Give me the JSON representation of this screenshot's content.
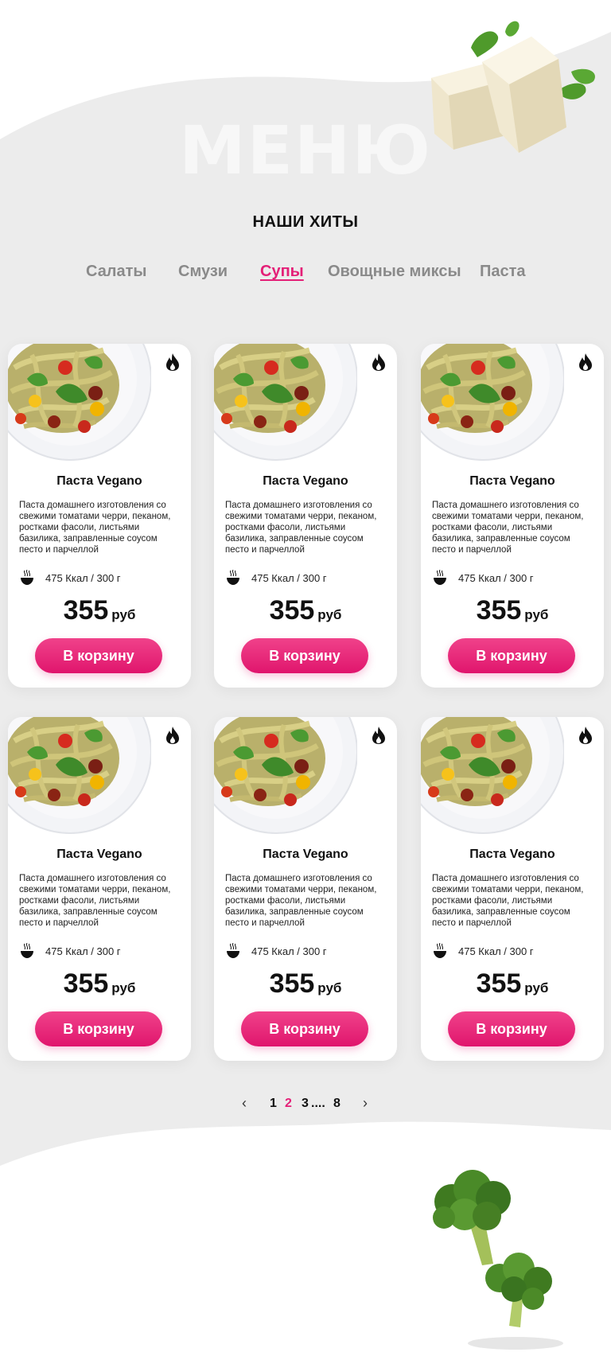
{
  "page": {
    "watermark": "МЕНЮ",
    "section_title": "НАШИ ХИТЫ"
  },
  "tabs": [
    {
      "label": "Салаты",
      "active": false
    },
    {
      "label": "Смузи",
      "active": false
    },
    {
      "label": "Супы ",
      "active": true
    },
    {
      "label": "Овощные миксы",
      "active": false
    },
    {
      "label": "Паста",
      "active": false
    }
  ],
  "cards": [
    {
      "name": "Паста Vegano",
      "description": "Паста домашнего изготовления со свежими томатами черри, пеканом, ростками фасоли, листьями базилика, заправленные соусом песто и парчеллой",
      "nutrition": "475 Ккал / 300 г",
      "price": "355",
      "currency": "руб",
      "button": "В корзину",
      "badge_icon": "fire-icon"
    },
    {
      "name": "Паста Vegano",
      "description": "Паста домашнего изготовления со свежими томатами черри, пеканом, ростками фасоли, листьями базилика, заправленные соусом песто и парчеллой",
      "nutrition": "475 Ккал / 300 г",
      "price": "355",
      "currency": "руб",
      "button": "В корзину",
      "badge_icon": "fire-icon"
    },
    {
      "name": "Паста Vegano",
      "description": "Паста домашнего изготовления со свежими томатами черри, пеканом, ростками фасоли, листьями базилика, заправленные соусом песто и парчеллой",
      "nutrition": "475 Ккал / 300 г",
      "price": "355",
      "currency": "руб",
      "button": "В корзину",
      "badge_icon": "fire-icon"
    },
    {
      "name": "Паста Vegano",
      "description": "Паста домашнего изготовления со свежими томатами черри, пеканом, ростками фасоли, листьями базилика, заправленные соусом песто и парчеллой",
      "nutrition": "475 Ккал / 300 г",
      "price": "355",
      "currency": "руб",
      "button": "В корзину",
      "badge_icon": "fire-icon"
    },
    {
      "name": "Паста Vegano",
      "description": "Паста домашнего изготовления со свежими томатами черри, пеканом, ростками фасоли, листьями базилика, заправленные соусом песто и парчеллой",
      "nutrition": "475 Ккал / 300 г",
      "price": "355",
      "currency": "руб",
      "button": "В корзину",
      "badge_icon": "fire-icon"
    },
    {
      "name": "Паста Vegano",
      "description": "Паста домашнего изготовления со свежими томатами черри, пеканом, ростками фасоли, листьями базилика, заправленные соусом песто и парчеллой",
      "nutrition": "475 Ккал / 300 г",
      "price": "355",
      "currency": "руб",
      "button": "В корзину",
      "badge_icon": "fire-icon"
    }
  ],
  "pagination": {
    "prev_icon": "chevron-left-icon",
    "pages": [
      "1",
      "2",
      "3",
      "....",
      "8"
    ],
    "current": "2",
    "next_icon": "chevron-right-icon"
  },
  "colors": {
    "accent": "#e41f77",
    "background": "#ececec",
    "tab_inactive": "#8a8a8a"
  }
}
